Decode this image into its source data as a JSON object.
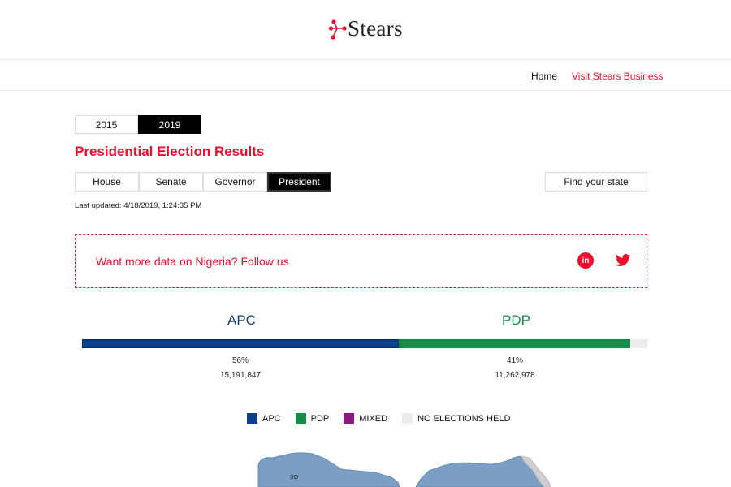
{
  "header": {
    "logo_text": "Stears"
  },
  "nav": {
    "home": "Home",
    "business": "Visit Stears Business"
  },
  "year_tabs": [
    {
      "label": "2015",
      "active": false
    },
    {
      "label": "2019",
      "active": true
    }
  ],
  "page_title": "Presidential Election Results",
  "race_tabs": [
    {
      "label": "House",
      "active": false
    },
    {
      "label": "Senate",
      "active": false
    },
    {
      "label": "Governor",
      "active": false
    },
    {
      "label": "President",
      "active": true
    }
  ],
  "find_state": "Find your state",
  "last_updated": "Last updated: 4/18/2019, 1:24:35 PM",
  "promo": {
    "text": "Want more data on Nigeria? Follow us",
    "linkedin_icon": "in"
  },
  "results": {
    "apc": {
      "name": "APC",
      "percent": "56%",
      "votes": "15,191,847",
      "share": 56
    },
    "pdp": {
      "name": "PDP",
      "percent": "41%",
      "votes": "11,262,978",
      "share": 41
    }
  },
  "legend": [
    {
      "label": "APC",
      "color": "#0b3f8e"
    },
    {
      "label": "PDP",
      "color": "#178a47"
    },
    {
      "label": "MIXED",
      "color": "#8b1a7e"
    },
    {
      "label": "NO ELECTIONS HELD",
      "color": "#ececec"
    }
  ],
  "map": {
    "state_label": "SO"
  },
  "colors": {
    "accent": "#e8112d",
    "apc": "#0b3f8e",
    "pdp": "#178a47",
    "map_fill": "#7a9ec4"
  }
}
